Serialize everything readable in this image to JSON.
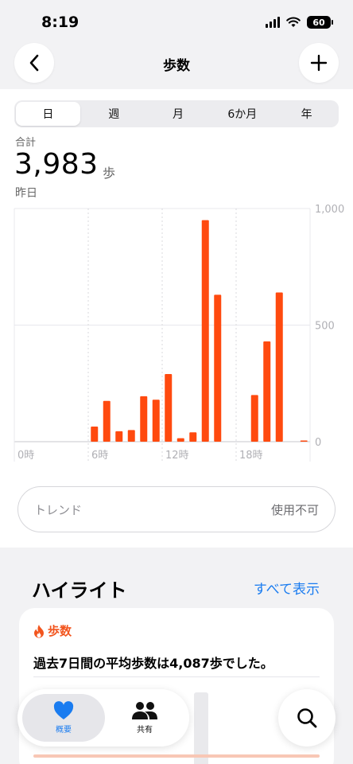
{
  "status": {
    "time": "8:19",
    "battery": "60"
  },
  "nav": {
    "title": "歩数"
  },
  "segments": [
    "日",
    "週",
    "月",
    "6か月",
    "年"
  ],
  "active_segment": 0,
  "summary": {
    "label": "合計",
    "value": "3,983",
    "unit": "歩",
    "date": "昨日"
  },
  "chart_data": {
    "type": "bar",
    "x_ticks": [
      "0時",
      "6時",
      "12時",
      "18時"
    ],
    "y_ticks": [
      "1,000",
      "500",
      "0"
    ],
    "ylim": [
      0,
      1000
    ],
    "xlim_hours": [
      0,
      24
    ],
    "grid": true,
    "bar_color": "#ff4a0f",
    "hours": [
      6.5,
      7.5,
      8.5,
      9.5,
      10.5,
      11.5,
      12.5,
      13.5,
      14.5,
      15.5,
      16.5,
      19.5,
      20.5,
      21.5,
      23.5
    ],
    "values": [
      65,
      175,
      45,
      50,
      195,
      180,
      290,
      15,
      40,
      950,
      630,
      200,
      430,
      640,
      5
    ]
  },
  "trend": {
    "label": "トレンド",
    "value": "使用不可"
  },
  "highlights": {
    "title": "ハイライト",
    "link": "すべて表示",
    "card": {
      "tag": "歩数",
      "text": "過去7日間の平均歩数は4,087歩でした。"
    }
  },
  "tabbar": {
    "summary": "概要",
    "share": "共有"
  },
  "colors": {
    "accent": "#1a7cf0",
    "orange": "#f2551e"
  }
}
